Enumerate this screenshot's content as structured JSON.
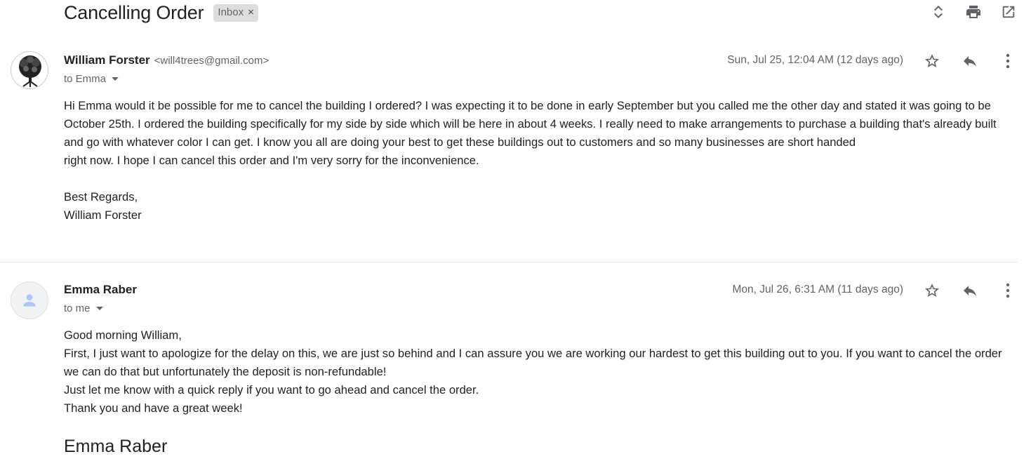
{
  "thread": {
    "subject": "Cancelling Order",
    "label": "Inbox",
    "label_remove": "×"
  },
  "toolbar": {
    "icons": [
      "expand-collapse-icon",
      "print-icon",
      "open-in-new-window-icon"
    ]
  },
  "messages": [
    {
      "sender_name": "William Forster",
      "sender_email": "<will4trees@gmail.com>",
      "to": "to Emma",
      "date": "Sun, Jul 25, 12:04 AM (12 days ago)",
      "avatar": "tree-photo",
      "body_lines": [
        "Hi Emma would it be possible for me to cancel the building I ordered? I was expecting it to be done in early September but you called me the other day and stated it was going to be October 25th. I ordered the building specifically for my side by side which will be here in about 4 weeks. I really need to make arrangements to purchase a building that's already built and go with whatever color I can get. I know you all are doing your best to get these buildings out to customers and so many businesses are short handed",
        "right now. I hope I can cancel this order and I'm very sorry for the inconvenience."
      ],
      "closing": "Best Regards,",
      "signature": "William Forster"
    },
    {
      "sender_name": "Emma Raber",
      "to": "to me",
      "date": "Mon, Jul 26, 6:31 AM (11 days ago)",
      "avatar": "default-person",
      "body_lines": [
        "Good morning William,",
        "First, I just want to apologize for the delay on this, we are just so behind and I can assure you we are working our hardest to get this building out to you. If you want to cancel the order we can do that but unfortunately the deposit is non-refundable!",
        "Just let me know with a quick reply if you want to go ahead and cancel the order.",
        "Thank you and have a great week!"
      ],
      "signature": "Emma Raber"
    }
  ],
  "colors": {
    "text": "#222222",
    "muted": "#5f6368",
    "chip_bg": "#dddddd",
    "divider": "#e5e5e5",
    "default_avatar": "#a8c7fa"
  }
}
